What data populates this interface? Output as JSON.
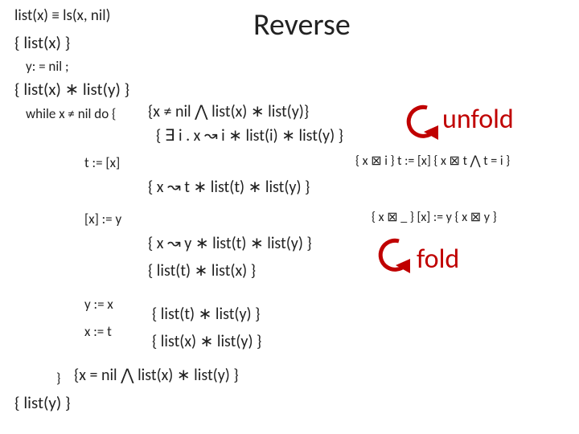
{
  "title": "Reverse",
  "header": {
    "def": "list(x) ≡ ls(x, nil)",
    "pre": "{ list(x) }",
    "init": "y: = nil ;"
  },
  "invariant": "{  list(x) ∗ list(y)  }",
  "loop_head": "while x ≠ nil do {",
  "unfold1": "{x ≠ nil ⋀  list(x) ∗ list(y)}",
  "unfold2": "{  ∃ i . x ↝ i ∗ list(i) ∗ list(y) }",
  "unfold_label": "unfold",
  "s1": {
    "code": "t := [x]",
    "note": "{ x ⊠ i }  t := [x]  { x ⊠ t ⋀ t = i }",
    "post": "{  x ↝ t ∗ list(t) ∗ list(y) }"
  },
  "s2": {
    "code": "[x] := y",
    "note": "{ x ⊠ _ }  [x] := y  { x ⊠ y }",
    "post1": "{  x ↝ y ∗ list(t) ∗ list(y) }",
    "post2": "{  list(t) ∗ list(x) }"
  },
  "fold_label": "fold",
  "s3": {
    "code": "y := x",
    "post": "{ list(t) ∗ list(y) }"
  },
  "s4": {
    "code": "x := t",
    "post": "{ list(x) ∗ list(y) }"
  },
  "loop_end": "}",
  "exit": "{x = nil ⋀ list(x) ∗ list(y) }",
  "final": "{ list(y) }"
}
